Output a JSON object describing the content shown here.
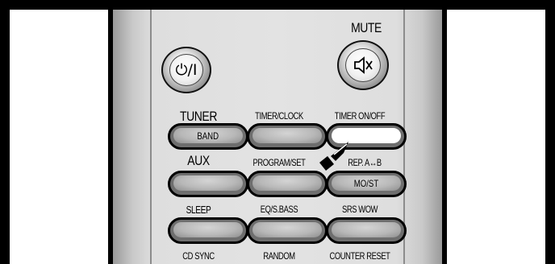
{
  "remote": {
    "power_button_label": "⏻/I",
    "mute_label": "MUTE",
    "rows": [
      {
        "labels": [
          "TUNER",
          "TIMER/CLOCK",
          "TIMER ON/OFF"
        ],
        "buttons": [
          "BAND",
          "",
          ""
        ]
      },
      {
        "labels": [
          "AUX",
          "PROGRAM/SET",
          "REP. A↔B"
        ],
        "buttons": [
          "",
          "",
          "MO/ST"
        ]
      },
      {
        "labels": [
          "SLEEP",
          "EQ/S.BASS",
          "SRS WOW"
        ],
        "buttons": [
          "",
          "",
          ""
        ]
      },
      {
        "labels": [
          "CD SYNC",
          "RANDOM",
          "COUNTER RESET"
        ],
        "buttons": []
      }
    ],
    "icons": {
      "power": "power-icon",
      "mute": "speaker-mute-icon",
      "pointer": "pointer-hand-icon"
    }
  }
}
